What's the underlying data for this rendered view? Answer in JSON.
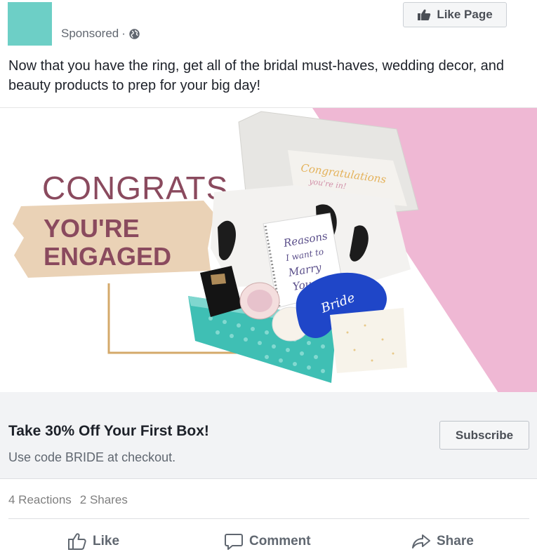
{
  "post": {
    "sponsored_label": "Sponsored",
    "separator": "·",
    "like_page_label": "Like Page",
    "text": "Now that you have the ring, get all of the bridal must-haves, wedding decor, and beauty products to prep for your big day!"
  },
  "ad_image": {
    "headline_1": "CONGRATS,",
    "headline_2": "YOU'RE",
    "headline_3": "ENGAGED",
    "card_text_1": "Congratulations",
    "card_text_2": "you're in!",
    "book_text_1": "Reasons",
    "book_text_2": "I want to",
    "book_text_3": "Marry",
    "book_text_4": "You",
    "mask_text": "Bride"
  },
  "cta": {
    "title": "Take 30% Off Your First Box!",
    "subtitle": "Use code BRIDE at checkout.",
    "button_label": "Subscribe"
  },
  "stats": {
    "reactions": "4 Reactions",
    "shares": "2 Shares"
  },
  "actions": {
    "like": "Like",
    "comment": "Comment",
    "share": "Share"
  },
  "colors": {
    "avatar": "#6dcfc6",
    "pink_panel": "#efb8d4",
    "headline_mauve": "#8a4a5e",
    "brush_tan": "#ead2b6",
    "box_teal": "#3fbfb4",
    "mask_blue": "#1f46c8",
    "gold_line": "#d4a96a"
  }
}
